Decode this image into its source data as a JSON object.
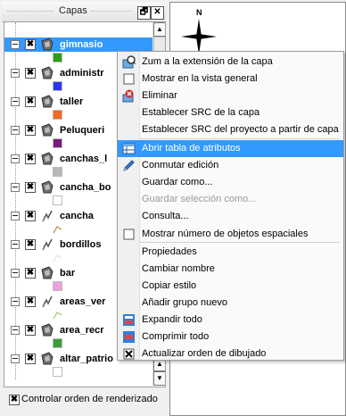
{
  "panel": {
    "title": "Capas",
    "float_button": "🗗",
    "close_button": "✕",
    "layers": [
      {
        "name": "gimnasio",
        "symbol_color": "#2e9e14",
        "type": "polygon",
        "checked": "✖"
      },
      {
        "name": "administr",
        "symbol_color": "#2a36e8",
        "type": "polygon",
        "checked": "✖"
      },
      {
        "name": "taller",
        "symbol_color": "#f06a22",
        "type": "polygon",
        "checked": "✖"
      },
      {
        "name": "Peluqueri",
        "symbol_color": "#7a1c7a",
        "type": "polygon",
        "checked": "✖"
      },
      {
        "name": "canchas_l",
        "symbol_color": "#b8b8b8",
        "type": "polygon",
        "checked": "✖"
      },
      {
        "name": "cancha_bo",
        "symbol_color": "#ffffff",
        "type": "polygon",
        "checked": "✖"
      },
      {
        "name": "cancha",
        "symbol_color": "#c8a060",
        "type": "line",
        "checked": "✖"
      },
      {
        "name": "bordillos",
        "symbol_color": "#e9e9e9",
        "type": "line",
        "checked": "✖"
      },
      {
        "name": "bar",
        "symbol_color": "#f0a0e0",
        "type": "polygon",
        "checked": "✖"
      },
      {
        "name": "areas_ver",
        "symbol_color": "#b0d090",
        "type": "line",
        "checked": "✖"
      },
      {
        "name": "area_recr",
        "symbol_color": "#3a9e3a",
        "type": "polygon",
        "checked": "✖"
      },
      {
        "name": "altar_patrio",
        "symbol_color": "#ffffff",
        "type": "polygon",
        "checked": "✖"
      }
    ],
    "render_order_checkbox": "✖",
    "render_order_label": "Controlar orden de renderizado"
  },
  "map": {
    "north_label": "N"
  },
  "context_menu": {
    "items": [
      {
        "label": "Zum a la extensión de la capa",
        "icon": "zoom-layer-icon",
        "state": "normal"
      },
      {
        "label": "Mostrar en la vista general",
        "icon": "checkbox-icon",
        "state": "normal"
      },
      {
        "label": "Eliminar",
        "icon": "remove-icon",
        "state": "normal"
      },
      {
        "label": "Establecer SRC de la capa",
        "icon": "",
        "state": "normal"
      },
      {
        "label": "Establecer SRC del proyecto a partir de capa",
        "icon": "",
        "state": "normal"
      },
      {
        "label": "Abrir tabla de atributos",
        "icon": "table-icon",
        "state": "highlighted"
      },
      {
        "label": "Conmutar edición",
        "icon": "pencil-icon",
        "state": "normal"
      },
      {
        "label": "Guardar como...",
        "icon": "",
        "state": "normal"
      },
      {
        "label": "Guardar selección como...",
        "icon": "",
        "state": "disabled"
      },
      {
        "label": "Consulta...",
        "icon": "",
        "state": "normal"
      },
      {
        "label": "Mostrar número de objetos espaciales",
        "icon": "checkbox-icon",
        "state": "normal"
      },
      {
        "label": "Propiedades",
        "icon": "",
        "state": "normal"
      },
      {
        "label": "Cambiar nombre",
        "icon": "",
        "state": "normal"
      },
      {
        "label": "Copiar estilo",
        "icon": "",
        "state": "normal"
      },
      {
        "label": "Añadir grupo nuevo",
        "icon": "",
        "state": "normal"
      },
      {
        "label": "Expandir todo",
        "icon": "expand-icon",
        "state": "normal"
      },
      {
        "label": "Comprimir todo",
        "icon": "collapse-icon",
        "state": "normal"
      },
      {
        "label": "Actualizar orden de dibujado",
        "icon": "checked-box-icon",
        "state": "normal"
      }
    ]
  },
  "colors": {
    "selection": "#3399ff",
    "menu_bg": "#fafafa"
  }
}
